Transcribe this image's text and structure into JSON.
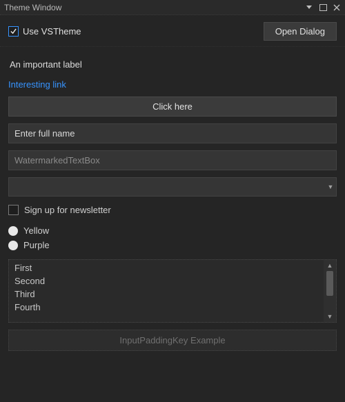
{
  "titlebar": {
    "title": "Theme Window"
  },
  "top": {
    "use_vstheme_label": "Use VSTheme",
    "use_vstheme_checked": true,
    "open_dialog_label": "Open Dialog"
  },
  "form": {
    "important_label": "An important label",
    "link_text": "Interesting link",
    "click_here_label": "Click here",
    "fullname_value": "Enter full name",
    "watermark_placeholder": "WatermarkedTextBox",
    "combo_selected": "",
    "newsletter_label": "Sign up for newsletter",
    "radio_yellow": "Yellow",
    "radio_purple": "Purple",
    "list_items": [
      "First",
      "Second",
      "Third",
      "Fourth"
    ],
    "inputpadding_label": "InputPaddingKey Example"
  }
}
